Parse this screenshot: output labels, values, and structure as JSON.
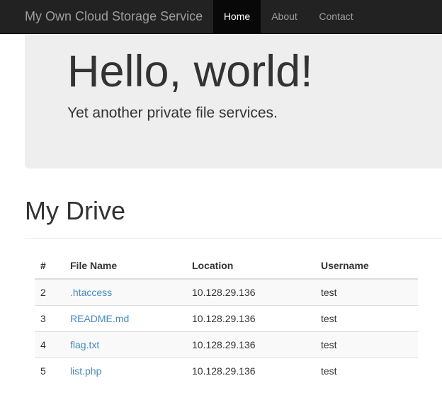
{
  "navbar": {
    "brand": "My Own Cloud Storage Service",
    "items": [
      {
        "label": "Home",
        "active": true
      },
      {
        "label": "About",
        "active": false
      },
      {
        "label": "Contact",
        "active": false
      }
    ]
  },
  "hero": {
    "title": "Hello, world!",
    "subtitle": "Yet another private file services."
  },
  "drive": {
    "title": "My Drive",
    "columns": [
      "#",
      "File Name",
      "Location",
      "Username"
    ],
    "rows": [
      {
        "num": "2",
        "name": ".htaccess",
        "location": "10.128.29.136",
        "username": "test"
      },
      {
        "num": "3",
        "name": "README.md",
        "location": "10.128.29.136",
        "username": "test"
      },
      {
        "num": "4",
        "name": "flag.txt",
        "location": "10.128.29.136",
        "username": "test"
      },
      {
        "num": "5",
        "name": "list.php",
        "location": "10.128.29.136",
        "username": "test"
      }
    ]
  },
  "colors": {
    "navbar_bg": "#222222",
    "link": "#428bca",
    "jumbotron_bg": "#eeeeee"
  }
}
